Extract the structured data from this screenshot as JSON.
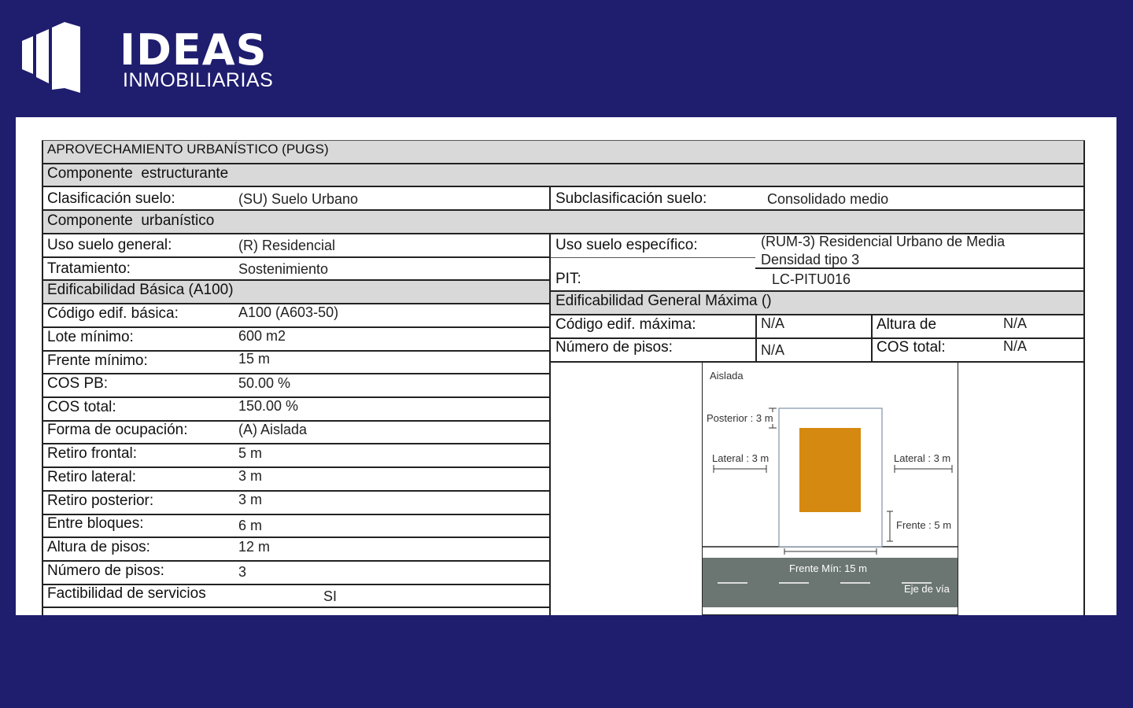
{
  "brand": {
    "name": "IDEAS",
    "tagline": "INMOBILIARIAS"
  },
  "document": {
    "title": "APROVECHAMIENTO URBANÍSTICO (PUGS)",
    "section_estructurante": "Componente  estructurante",
    "clasificacion_label": "Clasificación suelo:",
    "clasificacion_value": "(SU) Suelo Urbano",
    "subclasificacion_label": "Subclasificación suelo:",
    "subclasificacion_value": "Consolidado medio",
    "section_urbanistico": "Componente  urbanístico",
    "uso_general_label": "Uso suelo general:",
    "uso_general_value": "(R) Residencial",
    "uso_especifico_label": "Uso suelo específico:",
    "uso_especifico_value_1": "(RUM-3) Residencial Urbano de Media",
    "uso_especifico_value_2": "Densidad tipo 3",
    "tratamiento_label": "Tratamiento:",
    "tratamiento_value": "Sostenimiento",
    "pit_label": "PIT:",
    "pit_value": "LC-PITU016",
    "section_basica": "Edificabilidad Básica (A100)",
    "section_maxima": "Edificabilidad General Máxima ()",
    "codigo_max_label": "Código edif. máxima:",
    "codigo_max_value": "N/A",
    "altura_de_label": "Altura de",
    "altura_de_value": "N/A",
    "num_pisos_max_label": "Número de pisos:",
    "num_pisos_max_value": "N/A",
    "cos_total_max_label": "COS total:",
    "cos_total_max_value": "N/A",
    "rows": [
      {
        "label": "Código edif. básica:",
        "value": "A100 (A603-50)"
      },
      {
        "label": "Lote mínimo:",
        "value": "600 m2"
      },
      {
        "label": "Frente mínimo:",
        "value": "15 m"
      },
      {
        "label": "COS PB:",
        "value": "50.00 %"
      },
      {
        "label": "COS total:",
        "value": "150.00 %"
      },
      {
        "label": "Forma de ocupación:",
        "value": "(A) Aislada"
      },
      {
        "label": "Retiro frontal:",
        "value": "5 m"
      },
      {
        "label": "Retiro lateral:",
        "value": "3 m"
      },
      {
        "label": "Retiro posterior:",
        "value": "3 m"
      },
      {
        "label": "Entre bloques:",
        "value": "6 m"
      },
      {
        "label": "Altura de pisos:",
        "value": "12 m"
      },
      {
        "label": "Número de pisos:",
        "value": "3"
      },
      {
        "label": "Factibilidad de servicios",
        "value": "SI"
      }
    ]
  },
  "diagram": {
    "title": "Aislada",
    "posterior": "Posterior : 3 m",
    "lateral_left": "Lateral : 3 m",
    "lateral_right": "Lateral : 3 m",
    "frente": "Frente : 5 m",
    "frente_min": "Frente Mín: 15 m",
    "eje": "Eje de vía",
    "building_color": "#d68910",
    "road_color": "#6b7672"
  }
}
